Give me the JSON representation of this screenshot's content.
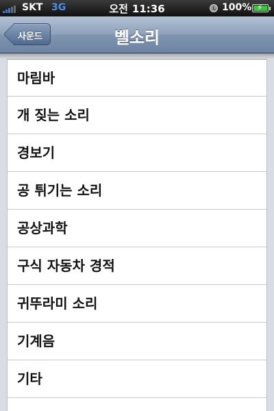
{
  "status_bar": {
    "carrier": "SKT",
    "network": "3G",
    "time_period": "오전",
    "time": "11:36",
    "battery": "100%",
    "battery_level": 1.0,
    "icons": [
      "signal-bars-icon",
      "orientation-lock-icon",
      "battery-charging-icon"
    ]
  },
  "nav": {
    "title": "벨소리",
    "back_label": "사운드",
    "back_icon": "back-arrow-icon"
  },
  "ringtones": [
    "마림바",
    "개 짖는 소리",
    "경보기",
    "공 튀기는 소리",
    "공상과학",
    "구식 자동차 경적",
    "귀뚜라미 소리",
    "기계음",
    "기타"
  ],
  "colors": {
    "nav_bar": "#8ea2bc",
    "background": "#d9dde3",
    "network": "#4a8ff0",
    "battery": "#39c43a"
  }
}
